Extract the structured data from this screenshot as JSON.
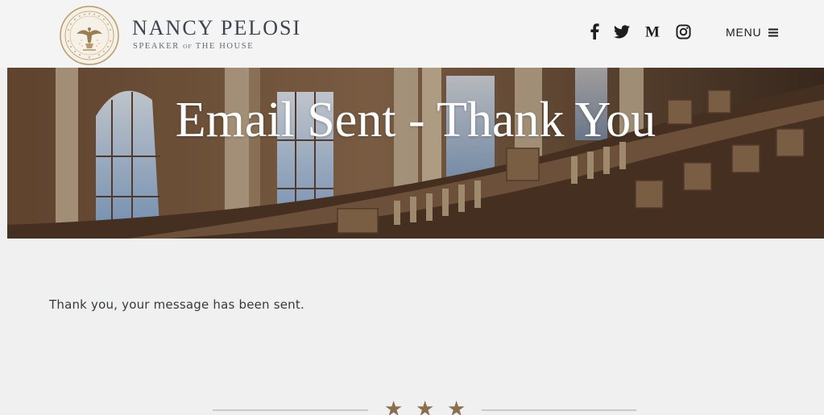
{
  "header": {
    "brand_name": "NANCY  PELOSI",
    "brand_sub_1": "SPEAKER",
    "brand_sub_of": "OF",
    "brand_sub_2": "THE HOUSE",
    "social": [
      {
        "icon": "facebook-icon",
        "glyph": "f"
      },
      {
        "icon": "twitter-icon"
      },
      {
        "icon": "medium-icon",
        "glyph": "M"
      },
      {
        "icon": "instagram-icon"
      }
    ],
    "menu_label": "MENU"
  },
  "hero": {
    "title": "Email Sent - Thank You"
  },
  "main": {
    "message": "Thank you, your message has been sent."
  },
  "divider": {
    "stars": [
      "★",
      "★",
      "★"
    ]
  },
  "colors": {
    "header_bg": "#f4f4f4",
    "page_bg": "#f0f0f0",
    "brand_text": "#3d4450",
    "accent_gold": "#8a6f4e",
    "hero_brown": "#4a3526"
  }
}
